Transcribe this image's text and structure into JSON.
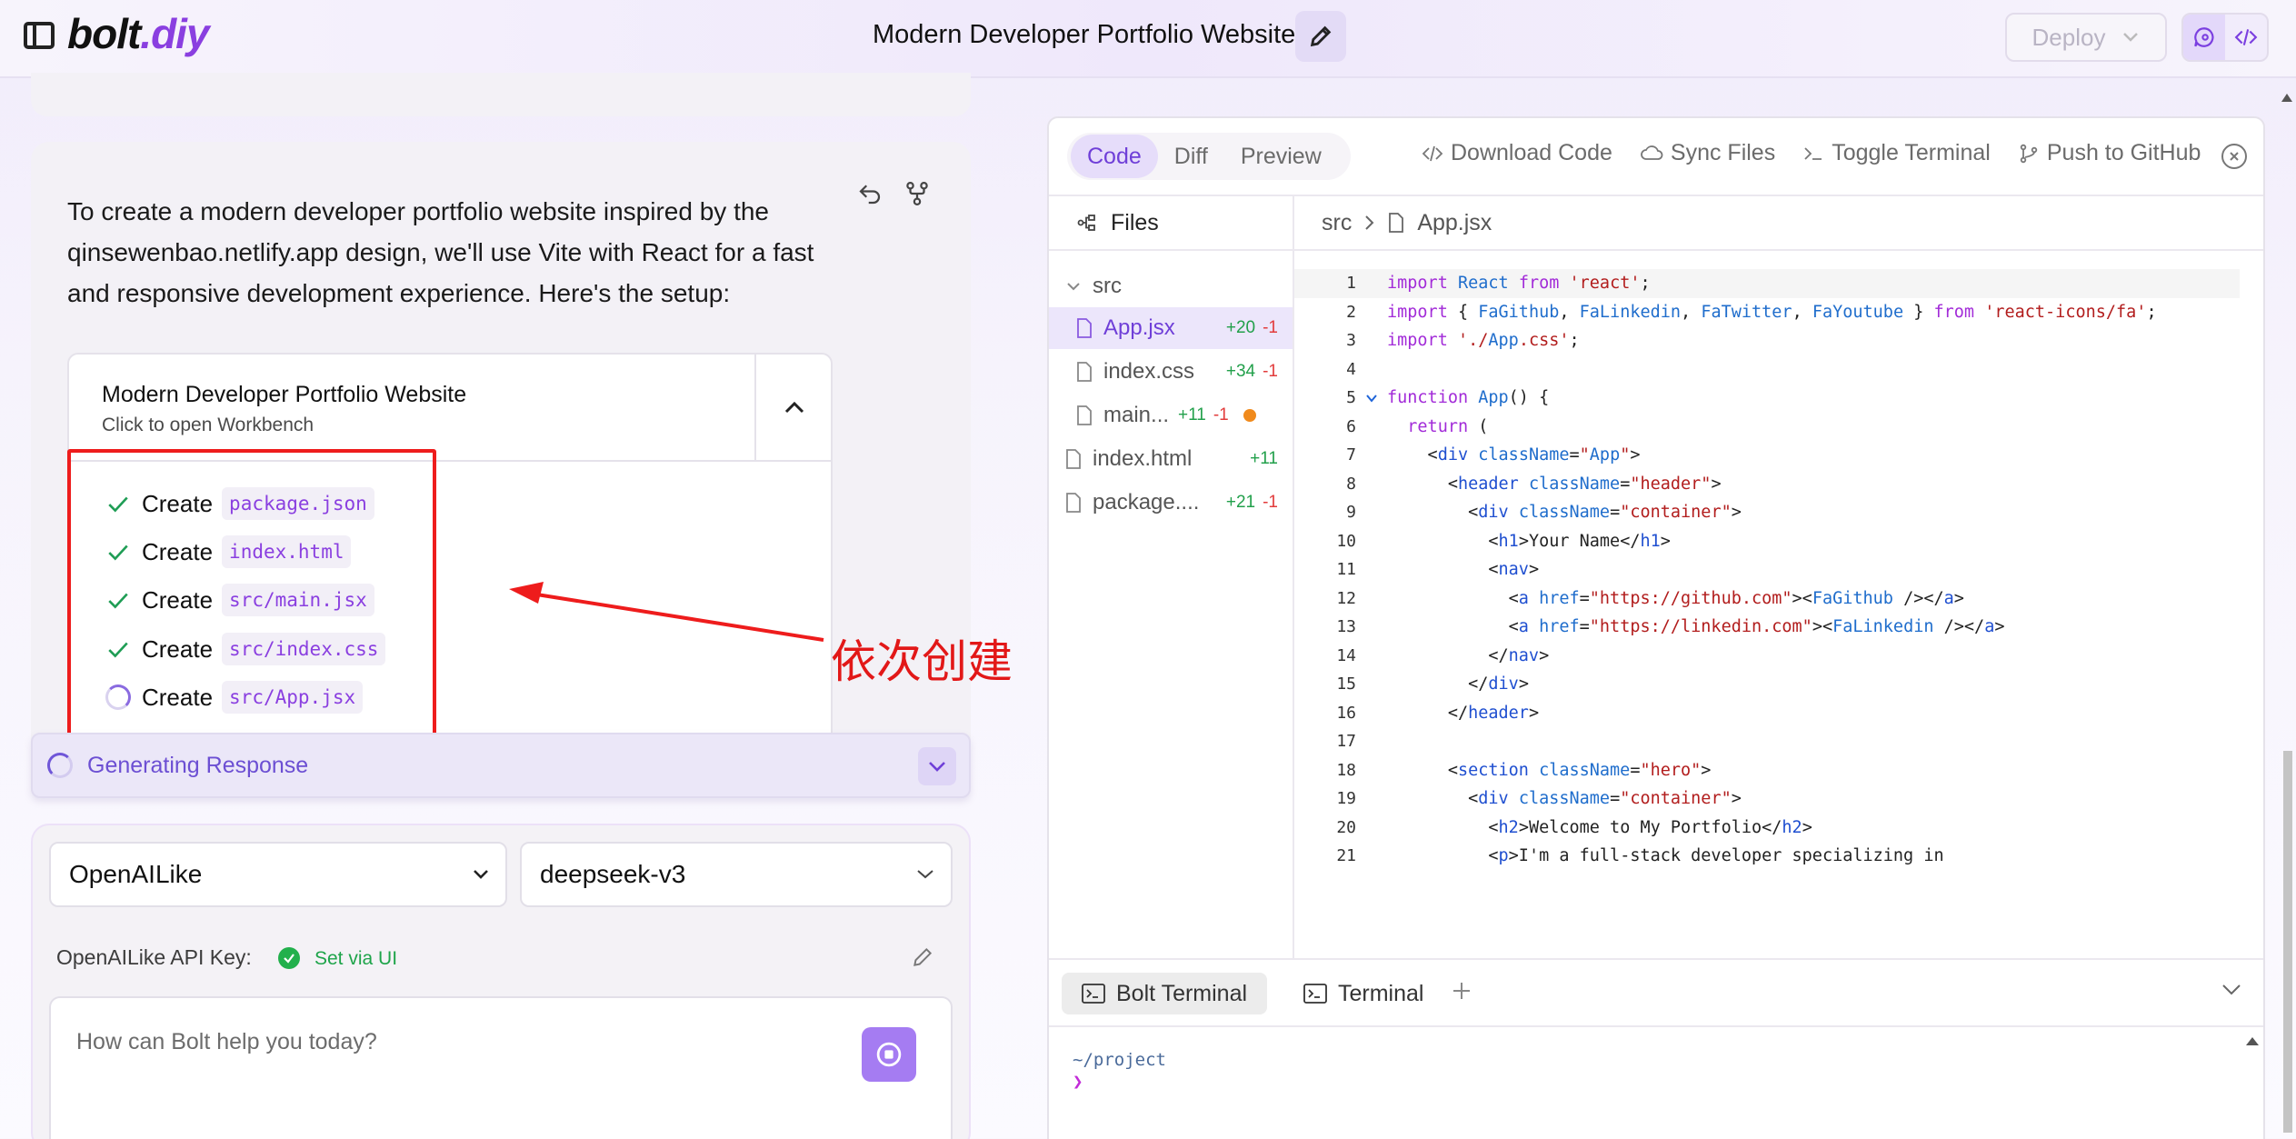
{
  "header": {
    "logo_part1": "bolt",
    "logo_part2": ".diy",
    "chat_title": "Modern Developer Portfolio Website",
    "deploy_label": "Deploy"
  },
  "chat": {
    "assistant_message": "To create a modern developer portfolio website inspired by the qinsewenbao.netlify.app design, we'll use Vite with React for a fast and responsive development experience. Here's the setup:",
    "artifact": {
      "title": "Modern Developer Portfolio Website",
      "subtitle": "Click to open Workbench"
    },
    "actions": [
      {
        "label": "Create",
        "file": "package.json",
        "status": "done"
      },
      {
        "label": "Create",
        "file": "index.html",
        "status": "done"
      },
      {
        "label": "Create",
        "file": "src/main.jsx",
        "status": "done"
      },
      {
        "label": "Create",
        "file": "src/index.css",
        "status": "done"
      },
      {
        "label": "Create",
        "file": "src/App.jsx",
        "status": "running"
      }
    ],
    "annotation": "依次创建",
    "generating_label": "Generating Response"
  },
  "input": {
    "provider": "OpenAILike",
    "model": "deepseek-v3",
    "api_key_label": "OpenAILike API Key:",
    "api_key_status": "Set via UI",
    "prompt_placeholder": "How can Bolt help you today?"
  },
  "workbench": {
    "tabs": [
      "Code",
      "Diff",
      "Preview"
    ],
    "active_tab": "Code",
    "actions": [
      "Download Code",
      "Sync Files",
      "Toggle Terminal",
      "Push to GitHub"
    ],
    "files_label": "Files",
    "tree": [
      {
        "name": "src",
        "type": "folder",
        "plus": "",
        "minus": ""
      },
      {
        "name": "App.jsx",
        "type": "file",
        "plus": "+20",
        "minus": "-1",
        "selected": true
      },
      {
        "name": "index.css",
        "type": "file",
        "plus": "+34",
        "minus": "-1"
      },
      {
        "name": "main...",
        "type": "file",
        "plus": "+11",
        "minus": "-1",
        "modified": true
      },
      {
        "name": "index.html",
        "type": "file",
        "plus": "+11",
        "minus": ""
      },
      {
        "name": "package....",
        "type": "file",
        "plus": "+21",
        "minus": "-1"
      }
    ],
    "breadcrumb": {
      "folder": "src",
      "file": "App.jsx"
    },
    "code_lines": [
      "import React from 'react';",
      "import { FaGithub, FaLinkedin, FaTwitter, FaYoutube } from 'react-icons/fa';",
      "import './App.css';",
      "",
      "function App() {",
      "  return (",
      "    <div className=\"App\">",
      "      <header className=\"header\">",
      "        <div className=\"container\">",
      "          <h1>Your Name</h1>",
      "          <nav>",
      "            <a href=\"https://github.com\"><FaGithub /></a>",
      "            <a href=\"https://linkedin.com\"><FaLinkedin /></a>",
      "          </nav>",
      "        </div>",
      "      </header>",
      "",
      "      <section className=\"hero\">",
      "        <div className=\"container\">",
      "          <h2>Welcome to My Portfolio</h2>",
      "          <p>I'm a full-stack developer specializing in"
    ],
    "terminal_tabs": [
      "Bolt Terminal",
      "Terminal"
    ],
    "terminal_path": "~/project",
    "terminal_prompt": "❯"
  },
  "colors": {
    "accent": "#8a3fe0",
    "annotation_red": "#ee1c1c",
    "added_green": "#22a04b",
    "removed_red": "#e23c3c"
  }
}
